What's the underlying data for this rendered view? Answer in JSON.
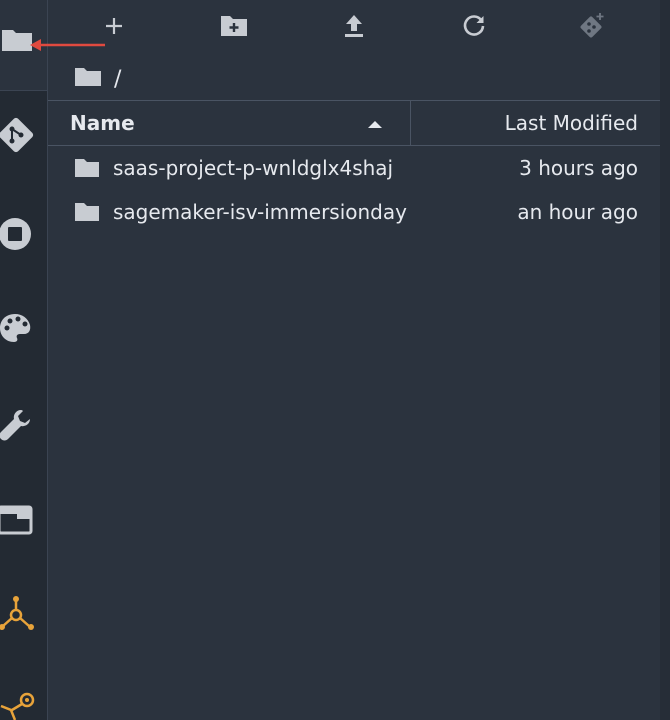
{
  "toolbar": {
    "new_launcher": "new-launcher",
    "new_folder": "new-folder",
    "upload": "upload",
    "refresh": "refresh",
    "git_clone": "git-clone"
  },
  "breadcrumb": {
    "path": "/"
  },
  "listing": {
    "columns": {
      "name": "Name",
      "last_modified": "Last Modified"
    },
    "sort": "name-ascending",
    "items": [
      {
        "name": "saas-project-p-wnldglx4shaj",
        "modified": "3 hours ago",
        "type": "folder"
      },
      {
        "name": "sagemaker-isv-immersionday",
        "modified": "an hour ago",
        "type": "folder"
      }
    ]
  },
  "activity_bar": {
    "icons": [
      "folder-icon",
      "git-icon",
      "stop-icon",
      "palette-icon",
      "wrench-icon",
      "window-icon",
      "experiments-icon",
      "pipelines-icon"
    ]
  },
  "colors": {
    "background": "#2b333e",
    "sidebar": "#232a33",
    "text": "#e6e9ee",
    "icon": "#c8ccd2",
    "accent_orange": "#e8a33a",
    "annotation_red": "#e04a3f"
  }
}
